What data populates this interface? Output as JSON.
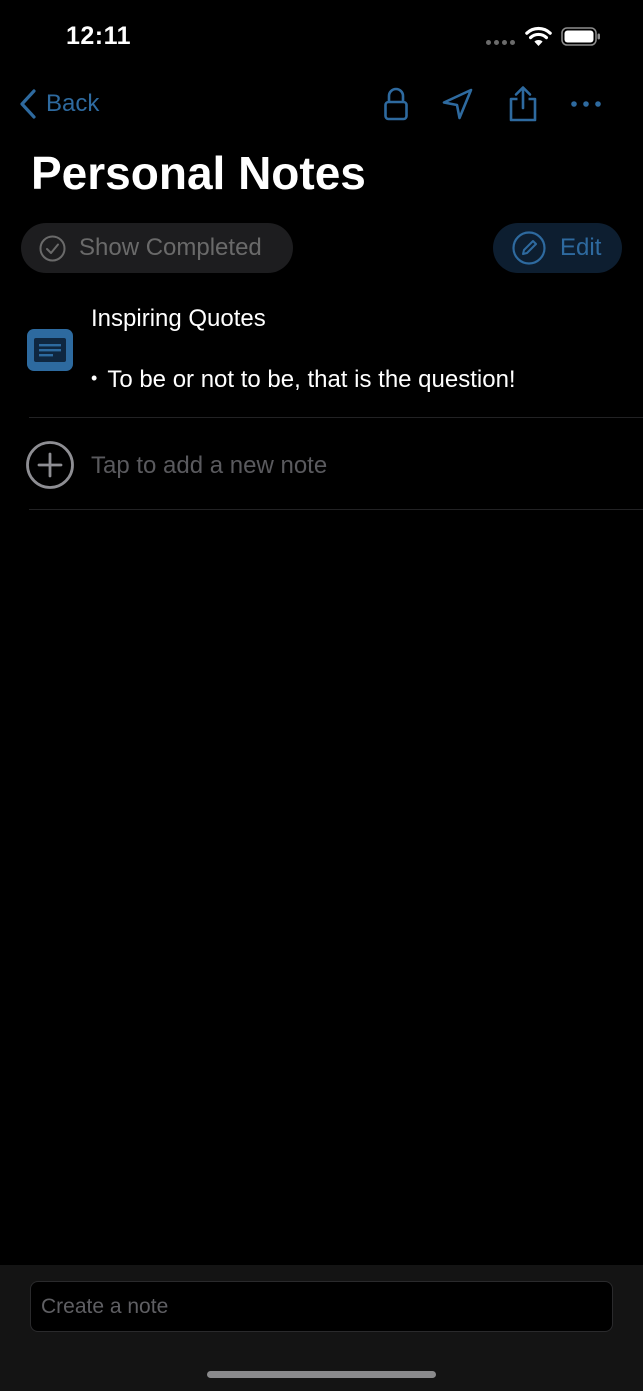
{
  "status_bar": {
    "time": "12:11"
  },
  "nav": {
    "back_label": "Back",
    "icons": [
      "lock-icon",
      "location-arrow-icon",
      "share-icon",
      "more-icon"
    ]
  },
  "page": {
    "title": "Personal Notes"
  },
  "filters": {
    "show_completed_label": "Show Completed",
    "edit_label": "Edit"
  },
  "notes": [
    {
      "title": "Inspiring Quotes",
      "bullet": "•",
      "body": "To be or not to be, that is the question!"
    }
  ],
  "add_row": {
    "label": "Tap to add a new note"
  },
  "composer": {
    "placeholder": "Create a note"
  },
  "colors": {
    "accent": "#2e6a9f",
    "background": "#000000",
    "pill_gray": "#1d1d1f",
    "placeholder": "#5a5a5e"
  }
}
